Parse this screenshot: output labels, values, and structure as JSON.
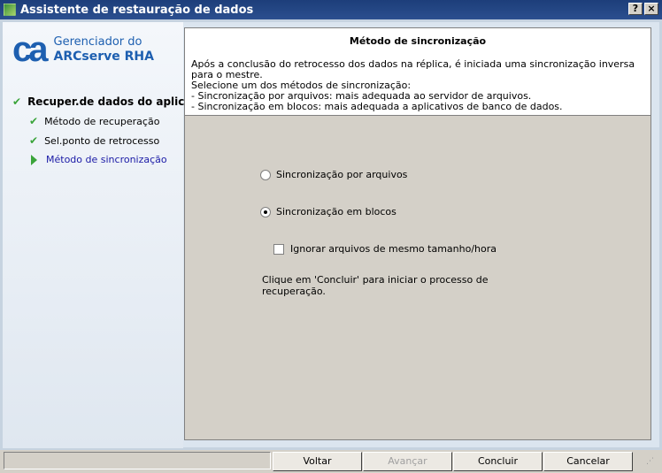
{
  "window": {
    "title": "Assistente de restauração de dados",
    "help": "?",
    "close": "×"
  },
  "logo": {
    "brand": "ca",
    "line1": "Gerenciador do",
    "line2": "ARCserve RHA"
  },
  "steps": [
    {
      "label": "Recuper.de dados do aplic.",
      "state": "done"
    },
    {
      "label": "Método de recuperação",
      "state": "done"
    },
    {
      "label": "Sel.ponto de retrocesso",
      "state": "done"
    },
    {
      "label": "Método de sincronização",
      "state": "current"
    }
  ],
  "header": {
    "title": "Método de sincronização",
    "lines": [
      "Após a conclusão do retrocesso dos dados na réplica, é iniciada uma sincronização inversa para o mestre.",
      "Selecione um dos métodos de sincronização:",
      "- Sincronização por arquivos: mais adequada ao servidor de arquivos.",
      "- Sincronização em blocos: mais adequada a aplicativos de banco de dados."
    ]
  },
  "options": {
    "file_sync": "Sincronização por arquivos",
    "block_sync": "Sincronização em blocos",
    "selected": "block_sync",
    "ignore_same": "Ignorar arquivos de mesmo tamanho/hora",
    "ignore_checked": false,
    "hint1": "Clique em 'Concluir' para iniciar o processo de",
    "hint2": "recuperação."
  },
  "buttons": {
    "back": "Voltar",
    "next": "Avançar",
    "finish": "Concluir",
    "cancel": "Cancelar"
  },
  "colors": {
    "accent": "#1d5fb0",
    "check": "#3aa43a",
    "current_step": "#1a1aa6"
  }
}
